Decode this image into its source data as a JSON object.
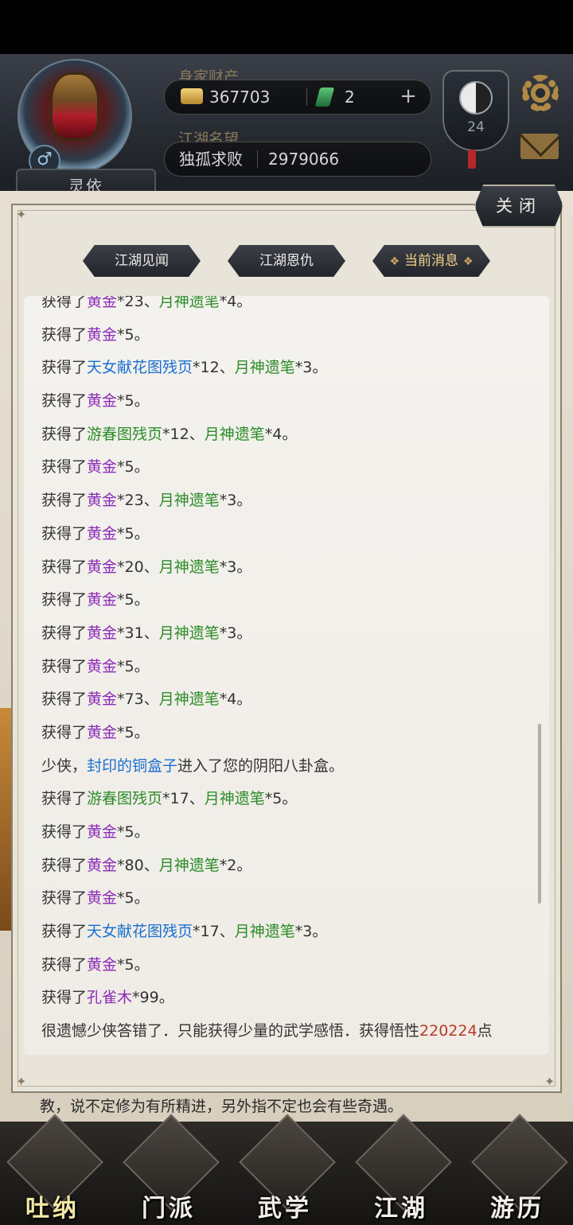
{
  "header": {
    "wealth_label": "身家财产",
    "gold_amount": "367703",
    "jade_amount": "2",
    "plus_symbol": "+",
    "fame_label": "江湖名望",
    "fame_title": "独孤求败",
    "fame_value": "2979066",
    "player_name": "灵依",
    "gender_symbol": "♂",
    "level": "24"
  },
  "panel": {
    "close_label": "关闭",
    "tabs": [
      "江湖见闻",
      "江湖恩仇",
      "当前消息"
    ],
    "active_tab": "当前消息",
    "tab_ornament": "❖"
  },
  "messages": [
    [
      {
        "t": "获得了"
      },
      {
        "t": "黄金",
        "c": "purple"
      },
      {
        "t": "*23、"
      },
      {
        "t": "月神遗笔",
        "c": "green"
      },
      {
        "t": "*4。"
      }
    ],
    [
      {
        "t": "获得了"
      },
      {
        "t": "黄金",
        "c": "purple"
      },
      {
        "t": "*5。"
      }
    ],
    [
      {
        "t": "获得了"
      },
      {
        "t": "天女献花图残页",
        "c": "blue"
      },
      {
        "t": "*12、"
      },
      {
        "t": "月神遗笔",
        "c": "green"
      },
      {
        "t": "*3。"
      }
    ],
    [
      {
        "t": "获得了"
      },
      {
        "t": "黄金",
        "c": "purple"
      },
      {
        "t": "*5。"
      }
    ],
    [
      {
        "t": "获得了"
      },
      {
        "t": "游春图残页",
        "c": "green"
      },
      {
        "t": "*12、"
      },
      {
        "t": "月神遗笔",
        "c": "green"
      },
      {
        "t": "*4。"
      }
    ],
    [
      {
        "t": "获得了"
      },
      {
        "t": "黄金",
        "c": "purple"
      },
      {
        "t": "*5。"
      }
    ],
    [
      {
        "t": "获得了"
      },
      {
        "t": "黄金",
        "c": "purple"
      },
      {
        "t": "*23、"
      },
      {
        "t": "月神遗笔",
        "c": "green"
      },
      {
        "t": "*3。"
      }
    ],
    [
      {
        "t": "获得了"
      },
      {
        "t": "黄金",
        "c": "purple"
      },
      {
        "t": "*5。"
      }
    ],
    [
      {
        "t": "获得了"
      },
      {
        "t": "黄金",
        "c": "purple"
      },
      {
        "t": "*20、"
      },
      {
        "t": "月神遗笔",
        "c": "green"
      },
      {
        "t": "*3。"
      }
    ],
    [
      {
        "t": "获得了"
      },
      {
        "t": "黄金",
        "c": "purple"
      },
      {
        "t": "*5。"
      }
    ],
    [
      {
        "t": "获得了"
      },
      {
        "t": "黄金",
        "c": "purple"
      },
      {
        "t": "*31、"
      },
      {
        "t": "月神遗笔",
        "c": "green"
      },
      {
        "t": "*3。"
      }
    ],
    [
      {
        "t": "获得了"
      },
      {
        "t": "黄金",
        "c": "purple"
      },
      {
        "t": "*5。"
      }
    ],
    [
      {
        "t": "获得了"
      },
      {
        "t": "黄金",
        "c": "purple"
      },
      {
        "t": "*73、"
      },
      {
        "t": "月神遗笔",
        "c": "green"
      },
      {
        "t": "*4。"
      }
    ],
    [
      {
        "t": "获得了"
      },
      {
        "t": "黄金",
        "c": "purple"
      },
      {
        "t": "*5。"
      }
    ],
    [
      {
        "t": "少侠，"
      },
      {
        "t": "封印的铜盒子",
        "c": "blue"
      },
      {
        "t": "进入了您的阴阳八卦盒。"
      }
    ],
    [
      {
        "t": "获得了"
      },
      {
        "t": "游春图残页",
        "c": "green"
      },
      {
        "t": "*17、"
      },
      {
        "t": "月神遗笔",
        "c": "green"
      },
      {
        "t": "*5。"
      }
    ],
    [
      {
        "t": "获得了"
      },
      {
        "t": "黄金",
        "c": "purple"
      },
      {
        "t": "*5。"
      }
    ],
    [
      {
        "t": "获得了"
      },
      {
        "t": "黄金",
        "c": "purple"
      },
      {
        "t": "*80、"
      },
      {
        "t": "月神遗笔",
        "c": "green"
      },
      {
        "t": "*2。"
      }
    ],
    [
      {
        "t": "获得了"
      },
      {
        "t": "黄金",
        "c": "purple"
      },
      {
        "t": "*5。"
      }
    ],
    [
      {
        "t": "获得了"
      },
      {
        "t": "天女献花图残页",
        "c": "blue"
      },
      {
        "t": "*17、"
      },
      {
        "t": "月神遗笔",
        "c": "green"
      },
      {
        "t": "*3。"
      }
    ],
    [
      {
        "t": "获得了"
      },
      {
        "t": "黄金",
        "c": "purple"
      },
      {
        "t": "*5。"
      }
    ],
    [
      {
        "t": "获得了"
      },
      {
        "t": "孔雀木",
        "c": "purple"
      },
      {
        "t": "*99。"
      }
    ],
    [
      {
        "t": "很遗憾少侠答错了．只能获得少量的武学感悟．获得悟性"
      },
      {
        "t": "220224",
        "c": "red"
      },
      {
        "t": "点"
      }
    ]
  ],
  "background_text": "教，说不定修为有所精进，另外指不定也会有些奇遇。",
  "bottom_nav": [
    "吐纳",
    "门派",
    "武学",
    "江湖",
    "游历"
  ],
  "colors": {
    "item_gold": "#8c2bb7",
    "item_green": "#2c8c28",
    "item_blue": "#1a6fd0",
    "highlight_number": "#b83a2a"
  }
}
